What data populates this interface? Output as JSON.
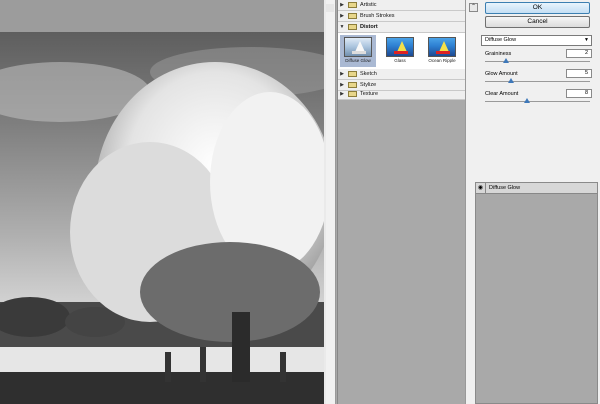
{
  "filter_categories": [
    {
      "label": "Artistic",
      "open": false
    },
    {
      "label": "Brush Strokes",
      "open": false
    },
    {
      "label": "Distort",
      "open": true
    },
    {
      "label": "Sketch",
      "open": false
    },
    {
      "label": "Stylize",
      "open": false
    },
    {
      "label": "Texture",
      "open": false
    }
  ],
  "distort_thumbnails": [
    {
      "label": "Diffuse Glow",
      "selected": true
    },
    {
      "label": "Glass",
      "selected": false
    },
    {
      "label": "Ocean Ripple",
      "selected": false
    }
  ],
  "buttons": {
    "ok": "OK",
    "cancel": "Cancel"
  },
  "filter_select": {
    "value": "Diffuse Glow"
  },
  "params": [
    {
      "label": "Graininess",
      "value": "2",
      "fraction": 0.2
    },
    {
      "label": "Glow Amount",
      "value": "5",
      "fraction": 0.25
    },
    {
      "label": "Clear Amount",
      "value": "8",
      "fraction": 0.4
    }
  ],
  "effect_layers": [
    {
      "label": "Diffuse Glow",
      "visible": true
    }
  ],
  "icons": {
    "collapse": "collapse-icon",
    "folder": "folder-icon",
    "eye": "eye-icon",
    "dropdown": "chevron-down-icon"
  }
}
